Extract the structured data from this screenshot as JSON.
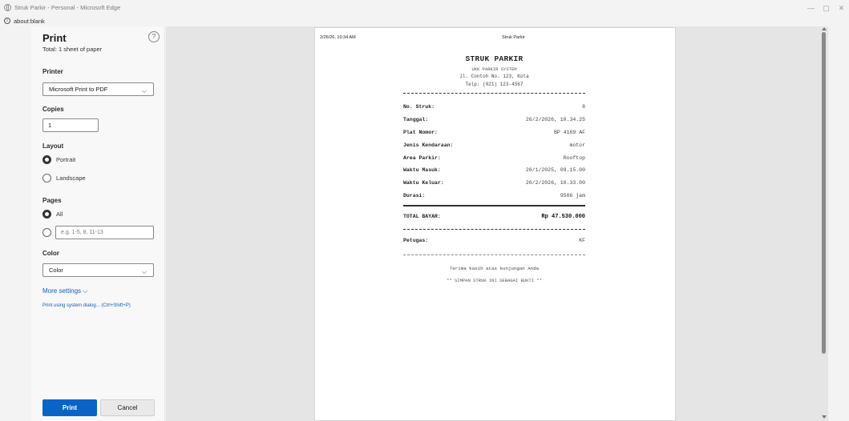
{
  "window": {
    "title": "Struk Parkir - Personal - Microsoft Edge",
    "address": "about:blank",
    "minimize": "—",
    "restore": "▢",
    "close": "✕"
  },
  "print_panel": {
    "title": "Print",
    "subtitle": "Total: 1 sheet of paper",
    "help": "?",
    "printer_label": "Printer",
    "printer_value": "Microsoft Print to PDF",
    "copies_label": "Copies",
    "copies_value": "1",
    "layout_label": "Layout",
    "layout_options": [
      "Portrait",
      "Landscape"
    ],
    "layout_selected": "Portrait",
    "pages_label": "Pages",
    "pages_all": "All",
    "pages_placeholder": "e.g. 1-5, 8, 11-13",
    "color_label": "Color",
    "color_value": "Color",
    "more_settings": "More settings ⌵",
    "system_dialog": "Print using system dialog... (Ctrl+Shift+P)",
    "print_button": "Print",
    "cancel_button": "Cancel",
    "accent_color": "#0a64c8",
    "chevron": "⌵"
  },
  "preview": {
    "header_date": "2/26/26, 10:34 AM",
    "header_title": "Struk Parkir",
    "receipt": {
      "title": "STRUK PARKIR",
      "system": "UKK PARKIR SYSTEM",
      "address": "Jl. Contoh No. 123, Kota",
      "phone": "Telp: (021) 123-4567",
      "rows": [
        {
          "key": "No. Struk:",
          "value": "8"
        },
        {
          "key": "Tanggal:",
          "value": "26/2/2026, 10.34.25"
        },
        {
          "key": "Plat Nomor:",
          "value": "BP 4169 AF"
        },
        {
          "key": "Jenis Kendaraan:",
          "value": "motor"
        },
        {
          "key": "Area Parkir:",
          "value": "Rooftop"
        },
        {
          "key": "Waktu Masuk:",
          "value": "26/1/2025, 09.15.00"
        },
        {
          "key": "Waktu Keluar:",
          "value": "26/2/2026, 10.33.00"
        },
        {
          "key": "Durasi:",
          "value": "9506 jam"
        }
      ],
      "total_label": "TOTAL BAYAR:",
      "total_value": "Rp 47.530.000",
      "officer_label": "Petugas:",
      "officer_value": "KF",
      "thanks": "Terima kasih atas kunjungan Anda",
      "keep_note": "** SIMPAN STRUK INI SEBAGAI BUKTI **"
    }
  }
}
